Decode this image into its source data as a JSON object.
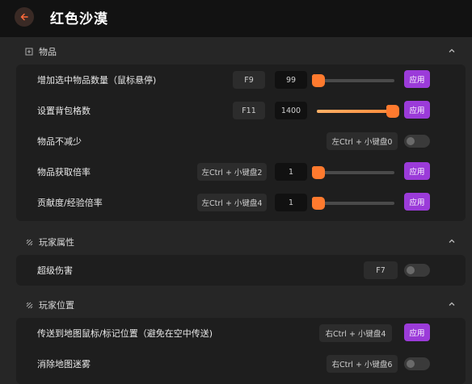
{
  "header": {
    "title": "红色沙漠"
  },
  "sections": {
    "items": {
      "title": "物品",
      "rows": {
        "increase_qty": {
          "label": "增加选中物品数量（鼠标悬停)",
          "key": "F9",
          "value": "99",
          "slider_fraction": 0.0,
          "apply": "应用"
        },
        "bag_slots": {
          "label": "设置背包格数",
          "key": "F11",
          "value": "1400",
          "slider_fraction": 1.0,
          "apply": "应用"
        },
        "no_decrease": {
          "label": "物品不减少",
          "key": "左Ctrl + 小键盘0"
        },
        "item_rate": {
          "label": "物品获取倍率",
          "key": "左Ctrl + 小键盘2",
          "value": "1",
          "slider_fraction": 0.0,
          "apply": "应用"
        },
        "exp_rate": {
          "label": "贡献度/经验倍率",
          "key": "左Ctrl + 小键盘4",
          "value": "1",
          "slider_fraction": 0.0,
          "apply": "应用"
        }
      }
    },
    "player_attr": {
      "title": "玩家属性",
      "rows": {
        "super_damage": {
          "label": "超级伤害",
          "key": "F7"
        }
      }
    },
    "player_pos": {
      "title": "玩家位置",
      "rows": {
        "teleport": {
          "label": "传送到地图鼠标/标记位置（避免在空中传送)",
          "key": "右Ctrl + 小键盘4",
          "apply": "应用"
        },
        "clear_fog": {
          "label": "消除地图迷雾",
          "key": "右Ctrl + 小键盘6"
        }
      }
    }
  },
  "colors": {
    "accent_purple": "#9b3bd9",
    "slider_orange": "#ff7a2e"
  },
  "icons": {
    "back": "arrow-left-icon",
    "collapse": "chevron-up-icon",
    "items_section": "box-icon",
    "player_section": "link-icon"
  }
}
